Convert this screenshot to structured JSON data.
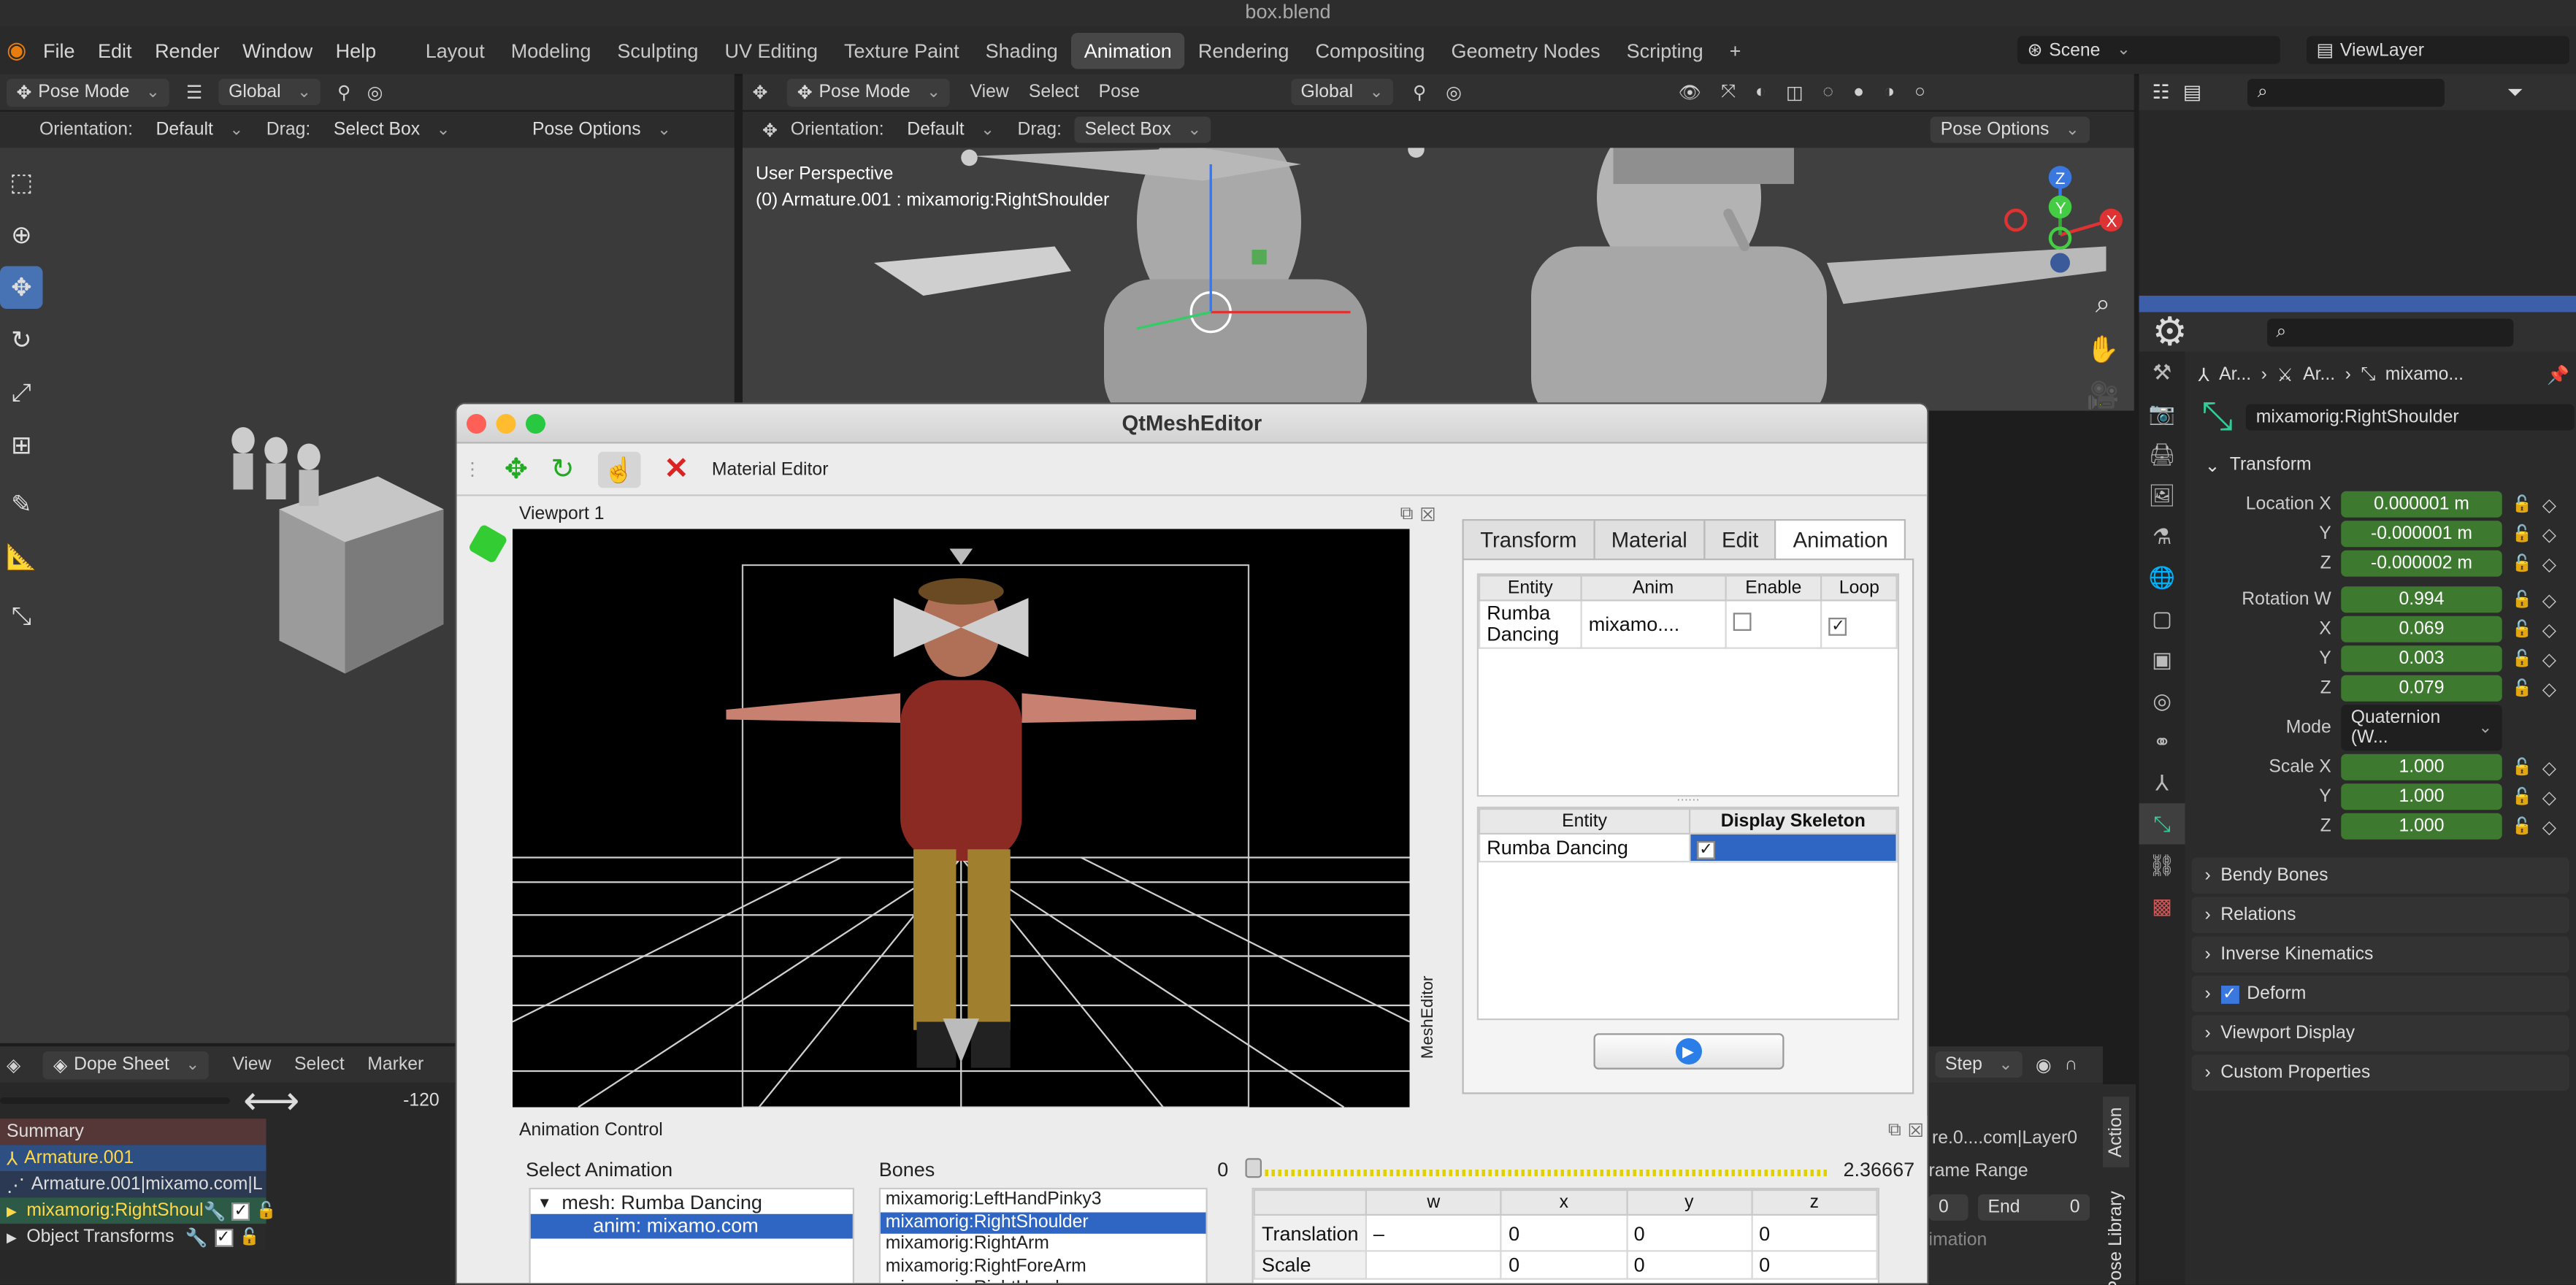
{
  "window": {
    "title": "box.blend"
  },
  "menu": [
    "File",
    "Edit",
    "Render",
    "Window",
    "Help"
  ],
  "workspaces": [
    "Layout",
    "Modeling",
    "Sculpting",
    "UV Editing",
    "Texture Paint",
    "Shading",
    "Animation",
    "Rendering",
    "Compositing",
    "Geometry Nodes",
    "Scripting",
    "+"
  ],
  "active_workspace": "Animation",
  "scene": {
    "label": "Scene",
    "view_layer": "ViewLayer"
  },
  "left_header": {
    "mode": "Pose Mode",
    "transform": "Global",
    "orientation_label": "Orientation:",
    "orientation": "Default",
    "drag_label": "Drag:",
    "drag": "Select Box",
    "pose_options": "Pose Options"
  },
  "vp_header": {
    "mode": "Pose Mode",
    "view": "View",
    "select": "Select",
    "pose": "Pose",
    "transform": "Global",
    "orientation_label": "Orientation:",
    "orientation": "Default",
    "drag_label": "Drag:",
    "drag": "Select Box",
    "pose_options": "Pose Options"
  },
  "viewport": {
    "perspective": "User Perspective",
    "object": "(0) Armature.001 : mixamorig:RightShoulder"
  },
  "props": {
    "breadcrumb": [
      "Ar...",
      "Ar...",
      "mixamo..."
    ],
    "bone_name": "mixamorig:RightShoulder",
    "transform_label": "Transform",
    "location": [
      {
        "l": "Location X",
        "v": "0.000001 m"
      },
      {
        "l": "Y",
        "v": "-0.000001 m"
      },
      {
        "l": "Z",
        "v": "-0.000002 m"
      }
    ],
    "rotation": [
      {
        "l": "Rotation W",
        "v": "0.994"
      },
      {
        "l": "X",
        "v": "0.069"
      },
      {
        "l": "Y",
        "v": "0.003"
      },
      {
        "l": "Z",
        "v": "0.079"
      }
    ],
    "mode_label": "Mode",
    "mode": "Quaternion (W...",
    "scale": [
      {
        "l": "Scale X",
        "v": "1.000"
      },
      {
        "l": "Y",
        "v": "1.000"
      },
      {
        "l": "Z",
        "v": "1.000"
      }
    ],
    "panels": [
      "Bendy Bones",
      "Relations",
      "Inverse Kinematics",
      "Deform",
      "Viewport Display",
      "Custom Properties"
    ]
  },
  "qt": {
    "title": "QtMeshEditor",
    "toolbar_label": "Material Editor",
    "viewport_title": "Viewport 1",
    "side_label": "MeshEditor",
    "tabs": [
      "Transform",
      "Material",
      "Edit",
      "Animation"
    ],
    "active_tab": "Animation",
    "anim_table": {
      "headers": [
        "Entity",
        "Anim",
        "Enable",
        "Loop"
      ],
      "rows": [
        {
          "entity": "Rumba Dancing",
          "anim": "mixamo....",
          "enable": "",
          "loop": "✓"
        }
      ]
    },
    "skel_table": {
      "headers": [
        "Entity",
        "Display Skeleton"
      ],
      "rows": [
        {
          "entity": "Rumba Dancing",
          "display": "✓"
        }
      ]
    },
    "anim_control": {
      "title": "Animation Control",
      "select_label": "Select Animation",
      "tree": {
        "mesh": "mesh: Rumba Dancing",
        "anim": "anim: mixamo.com"
      },
      "bones_label": "Bones",
      "bones": [
        "mixamorig:LeftHandPinky3",
        "mixamorig:RightShoulder",
        "mixamorig:RightArm",
        "mixamorig:RightForeArm",
        "mixamorig:RightHand"
      ],
      "selected_bone": "mixamorig:RightShoulder",
      "slider_min": "0",
      "slider_max": "2.36667",
      "table_headers": [
        "",
        "w",
        "x",
        "y",
        "z"
      ],
      "rows": [
        {
          "l": "Translation",
          "w": "–",
          "x": "0",
          "y": "0",
          "z": "0"
        },
        {
          "l": "Scale",
          "w": "",
          "x": "0",
          "y": "0",
          "z": "0"
        }
      ]
    }
  },
  "dope": {
    "editor": "Dope Sheet",
    "menus": [
      "View",
      "Select",
      "Marker"
    ],
    "frame": "-120",
    "rows": [
      {
        "label": "Summary",
        "kind": "summary"
      },
      {
        "label": "Armature.001",
        "kind": "object"
      },
      {
        "label": "Armature.001|mixamo.com|L",
        "kind": "action"
      },
      {
        "label": "mixamorig:RightShoul",
        "kind": "group"
      },
      {
        "label": "Object Transforms",
        "kind": "group2"
      }
    ]
  },
  "right_lower": {
    "step": "Step",
    "layer": "re.0....com|Layer0",
    "frame_range": "rame Range",
    "end_label": "End",
    "end_val": "0",
    "start_val": "0",
    "animation": "imation",
    "tab_action": "Action",
    "tab_pose_library": "Pose Library"
  }
}
